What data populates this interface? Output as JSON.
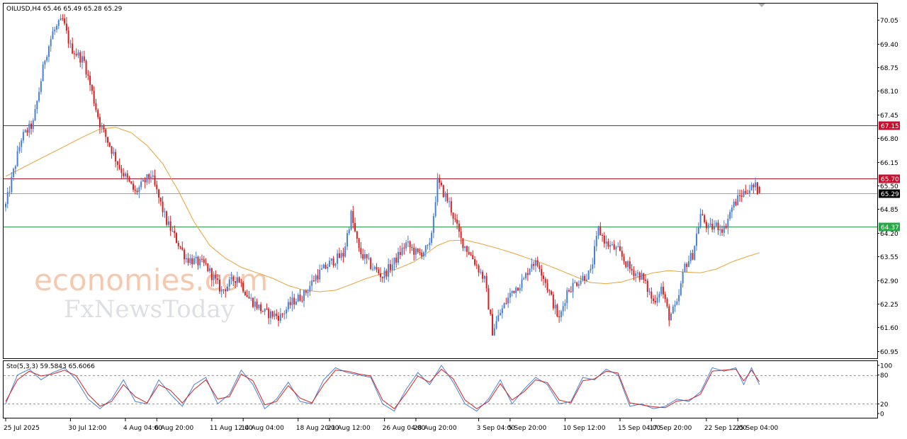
{
  "chart_data": [
    {
      "type": "candlestick",
      "symbol_header": "OILUSD,H4  65.46 65.49 65.28 65.29",
      "symbol": "OILUSD",
      "timeframe": "H4",
      "ohlc_last": {
        "open": 65.46,
        "high": 65.49,
        "low": 65.28,
        "close": 65.29
      },
      "ylim": [
        60.75,
        70.5
      ],
      "y_ticks": [
        70.05,
        69.4,
        68.75,
        68.1,
        67.45,
        66.8,
        66.15,
        65.5,
        64.85,
        64.2,
        63.55,
        62.9,
        62.25,
        61.6,
        60.95
      ],
      "x_ticks": [
        {
          "label": "25 Jul 2025",
          "index": 0
        },
        {
          "label": "30 Jul 12:00",
          "index": 33
        },
        {
          "label": "4 Aug 04:00",
          "index": 61
        },
        {
          "label": "6 Aug 20:00",
          "index": 77
        },
        {
          "label": "11 Aug 12:00",
          "index": 105
        },
        {
          "label": "14 Aug 04:00",
          "index": 121
        },
        {
          "label": "18 Aug 20:00",
          "index": 149
        },
        {
          "label": "21 Aug 12:00",
          "index": 165
        },
        {
          "label": "26 Aug 04:00",
          "index": 193
        },
        {
          "label": "28 Aug 20:00",
          "index": 209
        },
        {
          "label": "3 Sep 04:00",
          "index": 241
        },
        {
          "label": "5 Sep 20:00",
          "index": 257
        },
        {
          "label": "10 Sep 12:00",
          "index": 285
        },
        {
          "label": "15 Sep 04:00",
          "index": 313
        },
        {
          "label": "17 Sep 20:00",
          "index": 329
        },
        {
          "label": "22 Sep 12:00",
          "index": 357
        },
        {
          "label": "25 Sep 04:00",
          "index": 373
        }
      ],
      "candle_count": 385,
      "price_waypoints": [
        [
          0,
          64.95
        ],
        [
          8,
          66.8
        ],
        [
          14,
          67.2
        ],
        [
          20,
          69.0
        ],
        [
          24,
          69.7
        ],
        [
          29,
          70.05
        ],
        [
          33,
          69.3
        ],
        [
          40,
          68.9
        ],
        [
          48,
          67.2
        ],
        [
          58,
          66.0
        ],
        [
          66,
          65.3
        ],
        [
          74,
          65.8
        ],
        [
          82,
          64.5
        ],
        [
          92,
          63.5
        ],
        [
          102,
          63.3
        ],
        [
          110,
          62.6
        ],
        [
          118,
          63.0
        ],
        [
          124,
          62.4
        ],
        [
          132,
          62.0
        ],
        [
          140,
          61.9
        ],
        [
          146,
          62.3
        ],
        [
          152,
          62.5
        ],
        [
          158,
          63.0
        ],
        [
          166,
          63.4
        ],
        [
          172,
          63.6
        ],
        [
          176,
          64.7
        ],
        [
          180,
          63.7
        ],
        [
          186,
          63.3
        ],
        [
          192,
          63.0
        ],
        [
          198,
          63.4
        ],
        [
          204,
          63.9
        ],
        [
          210,
          63.6
        ],
        [
          216,
          63.8
        ],
        [
          220,
          65.6
        ],
        [
          226,
          65.0
        ],
        [
          232,
          64.0
        ],
        [
          238,
          63.5
        ],
        [
          244,
          62.9
        ],
        [
          248,
          61.5
        ],
        [
          252,
          62.0
        ],
        [
          258,
          62.6
        ],
        [
          264,
          62.9
        ],
        [
          268,
          63.4
        ],
        [
          272,
          63.3
        ],
        [
          278,
          62.4
        ],
        [
          282,
          61.8
        ],
        [
          286,
          62.6
        ],
        [
          292,
          62.9
        ],
        [
          298,
          63.1
        ],
        [
          302,
          64.3
        ],
        [
          306,
          63.9
        ],
        [
          312,
          63.7
        ],
        [
          318,
          63.2
        ],
        [
          324,
          63.0
        ],
        [
          330,
          62.3
        ],
        [
          334,
          62.7
        ],
        [
          338,
          61.9
        ],
        [
          342,
          62.2
        ],
        [
          346,
          63.3
        ],
        [
          350,
          63.6
        ],
        [
          354,
          64.7
        ],
        [
          358,
          64.3
        ],
        [
          362,
          64.4
        ],
        [
          366,
          64.3
        ],
        [
          370,
          64.9
        ],
        [
          374,
          65.2
        ],
        [
          378,
          65.4
        ],
        [
          382,
          65.46
        ],
        [
          384,
          65.29
        ]
      ],
      "ma_waypoints": [
        [
          0,
          65.75
        ],
        [
          20,
          66.3
        ],
        [
          40,
          66.85
        ],
        [
          48,
          67.05
        ],
        [
          56,
          67.1
        ],
        [
          64,
          66.95
        ],
        [
          72,
          66.6
        ],
        [
          80,
          66.1
        ],
        [
          88,
          65.35
        ],
        [
          96,
          64.5
        ],
        [
          104,
          63.85
        ],
        [
          112,
          63.5
        ],
        [
          120,
          63.25
        ],
        [
          128,
          63.1
        ],
        [
          136,
          62.95
        ],
        [
          144,
          62.75
        ],
        [
          152,
          62.62
        ],
        [
          160,
          62.58
        ],
        [
          168,
          62.62
        ],
        [
          176,
          62.78
        ],
        [
          184,
          62.95
        ],
        [
          192,
          63.08
        ],
        [
          200,
          63.22
        ],
        [
          208,
          63.4
        ],
        [
          214,
          63.62
        ],
        [
          220,
          63.85
        ],
        [
          226,
          63.98
        ],
        [
          234,
          64.0
        ],
        [
          242,
          63.9
        ],
        [
          250,
          63.78
        ],
        [
          258,
          63.65
        ],
        [
          266,
          63.5
        ],
        [
          274,
          63.35
        ],
        [
          282,
          63.18
        ],
        [
          290,
          63.0
        ],
        [
          298,
          62.83
        ],
        [
          306,
          62.8
        ],
        [
          314,
          62.85
        ],
        [
          322,
          62.98
        ],
        [
          330,
          63.1
        ],
        [
          338,
          63.16
        ],
        [
          346,
          63.12
        ],
        [
          354,
          63.1
        ],
        [
          362,
          63.2
        ],
        [
          370,
          63.4
        ],
        [
          378,
          63.55
        ],
        [
          384,
          63.65
        ]
      ],
      "horizontal_levels": [
        {
          "value": 67.15,
          "label": "67.15",
          "color": "#b5172b",
          "label_bg": "#c8102e"
        },
        {
          "value": 65.7,
          "label": "65.70",
          "color": "#b5172b",
          "label_bg": "#c8102e"
        },
        {
          "value": 65.29,
          "label": "65.29",
          "color": "#a0a0a0",
          "label_bg": "#000000"
        },
        {
          "value": 64.37,
          "label": "64.37",
          "color": "#2e9d4a",
          "label_bg": "#27a844"
        }
      ],
      "colors": {
        "bull_candle": "#4a7fd6",
        "bear_candle": "#d42020",
        "moving_average": "#e8a33a",
        "grid_frame": "#000000"
      }
    },
    {
      "type": "line",
      "indicator_header": "Sto(5,3,3) 59.5843 65.6066",
      "name": "Stochastic",
      "params": "5,3,3",
      "main_value": 59.5843,
      "signal_value": 65.6066,
      "ylim": [
        0,
        100
      ],
      "y_ticks": [
        100,
        80,
        20,
        0
      ],
      "levels": [
        80,
        20
      ],
      "series": [
        {
          "name": "main",
          "color": "#4a7fd6",
          "waypoints": [
            [
              0,
              20
            ],
            [
              6,
              80
            ],
            [
              12,
              92
            ],
            [
              18,
              70
            ],
            [
              24,
              85
            ],
            [
              30,
              95
            ],
            [
              36,
              70
            ],
            [
              42,
              30
            ],
            [
              48,
              10
            ],
            [
              54,
              30
            ],
            [
              60,
              70
            ],
            [
              66,
              25
            ],
            [
              72,
              20
            ],
            [
              78,
              70
            ],
            [
              84,
              40
            ],
            [
              90,
              15
            ],
            [
              96,
              60
            ],
            [
              102,
              75
            ],
            [
              108,
              20
            ],
            [
              114,
              40
            ],
            [
              120,
              90
            ],
            [
              126,
              60
            ],
            [
              132,
              10
            ],
            [
              138,
              30
            ],
            [
              144,
              65
            ],
            [
              150,
              25
            ],
            [
              156,
              20
            ],
            [
              162,
              70
            ],
            [
              168,
              95
            ],
            [
              174,
              85
            ],
            [
              180,
              80
            ],
            [
              186,
              75
            ],
            [
              192,
              20
            ],
            [
              198,
              5
            ],
            [
              204,
              50
            ],
            [
              210,
              85
            ],
            [
              216,
              60
            ],
            [
              222,
              100
            ],
            [
              228,
              65
            ],
            [
              234,
              20
            ],
            [
              240,
              5
            ],
            [
              246,
              30
            ],
            [
              252,
              70
            ],
            [
              258,
              20
            ],
            [
              264,
              50
            ],
            [
              270,
              75
            ],
            [
              276,
              60
            ],
            [
              282,
              20
            ],
            [
              288,
              25
            ],
            [
              294,
              75
            ],
            [
              300,
              70
            ],
            [
              306,
              92
            ],
            [
              312,
              80
            ],
            [
              318,
              15
            ],
            [
              324,
              20
            ],
            [
              330,
              10
            ],
            [
              336,
              15
            ],
            [
              342,
              30
            ],
            [
              348,
              25
            ],
            [
              354,
              45
            ],
            [
              360,
              95
            ],
            [
              366,
              88
            ],
            [
              372,
              95
            ],
            [
              376,
              60
            ],
            [
              380,
              95
            ],
            [
              384,
              60
            ]
          ]
        },
        {
          "name": "signal",
          "color": "#d42020",
          "waypoints": [
            [
              0,
              25
            ],
            [
              6,
              70
            ],
            [
              12,
              88
            ],
            [
              18,
              78
            ],
            [
              24,
              82
            ],
            [
              30,
              90
            ],
            [
              36,
              78
            ],
            [
              42,
              40
            ],
            [
              48,
              15
            ],
            [
              54,
              25
            ],
            [
              60,
              60
            ],
            [
              66,
              35
            ],
            [
              72,
              22
            ],
            [
              78,
              60
            ],
            [
              84,
              48
            ],
            [
              90,
              22
            ],
            [
              96,
              50
            ],
            [
              102,
              70
            ],
            [
              108,
              30
            ],
            [
              114,
              35
            ],
            [
              120,
              82
            ],
            [
              126,
              68
            ],
            [
              132,
              18
            ],
            [
              138,
              25
            ],
            [
              144,
              58
            ],
            [
              150,
              32
            ],
            [
              156,
              22
            ],
            [
              162,
              60
            ],
            [
              168,
              90
            ],
            [
              174,
              88
            ],
            [
              180,
              82
            ],
            [
              186,
              78
            ],
            [
              192,
              28
            ],
            [
              198,
              10
            ],
            [
              204,
              42
            ],
            [
              210,
              78
            ],
            [
              216,
              65
            ],
            [
              222,
              92
            ],
            [
              228,
              72
            ],
            [
              234,
              28
            ],
            [
              240,
              10
            ],
            [
              246,
              25
            ],
            [
              252,
              62
            ],
            [
              258,
              28
            ],
            [
              264,
              45
            ],
            [
              270,
              70
            ],
            [
              276,
              64
            ],
            [
              282,
              28
            ],
            [
              288,
              22
            ],
            [
              294,
              68
            ],
            [
              300,
              72
            ],
            [
              306,
              88
            ],
            [
              312,
              84
            ],
            [
              318,
              22
            ],
            [
              324,
              18
            ],
            [
              330,
              14
            ],
            [
              336,
              12
            ],
            [
              342,
              26
            ],
            [
              348,
              28
            ],
            [
              354,
              40
            ],
            [
              360,
              88
            ],
            [
              366,
              90
            ],
            [
              372,
              92
            ],
            [
              376,
              68
            ],
            [
              380,
              90
            ],
            [
              384,
              66
            ]
          ]
        }
      ]
    }
  ],
  "watermark": {
    "line1": "economies.com",
    "line2": "FxNewsToday"
  }
}
